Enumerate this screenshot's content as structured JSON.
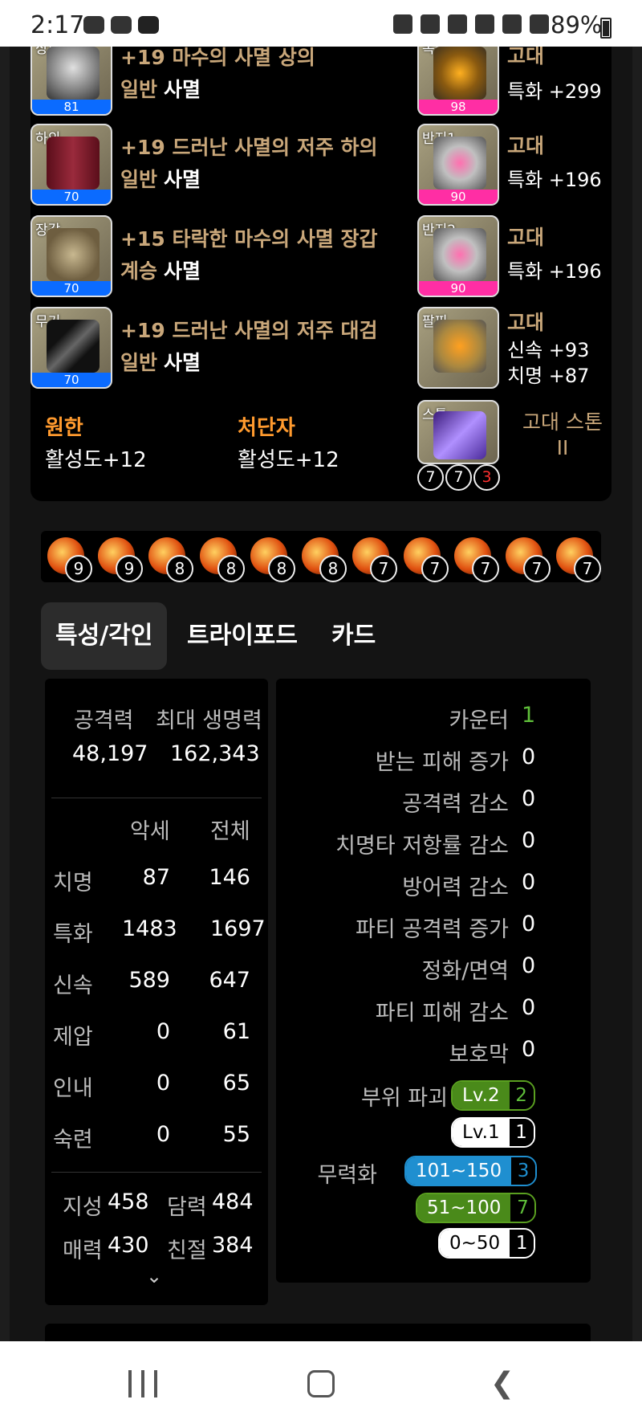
{
  "status_bar": {
    "time": "2:17",
    "battery": "89%",
    "left_icons": [
      "game-icon",
      "kakaotalk-icon",
      "youtube-icon"
    ],
    "right_icons": [
      "clean-icon",
      "alarm-icon",
      "mute-icon",
      "hd-voice-icon",
      "lte-icon",
      "signal-icon"
    ]
  },
  "equipment": {
    "left": [
      {
        "slot": "상의",
        "quality": "81",
        "name": "+19 마수의 사멸 상의",
        "tier": "일반",
        "set": "사멸",
        "bar": "blue"
      },
      {
        "slot": "하의",
        "quality": "70",
        "name": "+19 드러난 사멸의 저주 하의",
        "tier": "일반",
        "set": "사멸",
        "bar": "blue"
      },
      {
        "slot": "장갑",
        "quality": "70",
        "name": "+15 타락한 마수의 사멸 장갑",
        "tier": "계승",
        "set": "사멸",
        "bar": "blue"
      },
      {
        "slot": "무기",
        "quality": "70",
        "name": "+19 드러난 사멸의 저주 대검",
        "tier": "일반",
        "set": "사멸",
        "bar": "blue"
      }
    ],
    "right": [
      {
        "slot": "목걸이",
        "quality": "98",
        "grade": "고대",
        "stats": [
          "특화 +299"
        ]
      },
      {
        "slot": "반지1",
        "quality": "90",
        "grade": "고대",
        "stats": [
          "특화 +196"
        ]
      },
      {
        "slot": "반지2",
        "quality": "90",
        "grade": "고대",
        "stats": [
          "특화 +196"
        ]
      },
      {
        "slot": "팔찌",
        "grade": "고대",
        "stats": [
          "신속 +93",
          "치명 +87"
        ]
      }
    ],
    "engravings": [
      {
        "name": "원한",
        "value": "활성도+12"
      },
      {
        "name": "처단자",
        "value": "활성도+12"
      }
    ],
    "stone": {
      "slot": "스톤",
      "name": "고대 스톤 II",
      "nums": [
        "7",
        "7",
        "3"
      ]
    }
  },
  "gems": [
    "9",
    "9",
    "8",
    "8",
    "8",
    "8",
    "7",
    "7",
    "7",
    "7",
    "7"
  ],
  "tabs": [
    "특성/각인",
    "트라이포드",
    "카드"
  ],
  "stats": {
    "attack_label": "공격력",
    "attack_value": "48,197",
    "hp_label": "최대 생명력",
    "hp_value": "162,343",
    "col_accessory": "악세",
    "col_total": "전체",
    "rows": [
      {
        "name": "치명",
        "acc": "87",
        "total": "146"
      },
      {
        "name": "특화",
        "acc": "1483",
        "total": "1697"
      },
      {
        "name": "신속",
        "acc": "589",
        "total": "647"
      },
      {
        "name": "제압",
        "acc": "0",
        "total": "61"
      },
      {
        "name": "인내",
        "acc": "0",
        "total": "65"
      },
      {
        "name": "숙련",
        "acc": "0",
        "total": "55"
      }
    ],
    "base": [
      {
        "name": "지성",
        "value": "458"
      },
      {
        "name": "담력",
        "value": "484"
      },
      {
        "name": "매력",
        "value": "430"
      },
      {
        "name": "친절",
        "value": "384"
      }
    ]
  },
  "combat": {
    "rows": [
      {
        "label": "카운터",
        "value": "1"
      },
      {
        "label": "받는 피해 증가",
        "value": "0"
      },
      {
        "label": "공격력 감소",
        "value": "0"
      },
      {
        "label": "치명타 저항률 감소",
        "value": "0"
      },
      {
        "label": "방어력 감소",
        "value": "0"
      },
      {
        "label": "파티 공격력 증가",
        "value": "0"
      },
      {
        "label": "정화/면역",
        "value": "0"
      },
      {
        "label": "파티 피해 감소",
        "value": "0"
      },
      {
        "label": "보호막",
        "value": "0"
      }
    ],
    "part_break_label": "부위 파괴",
    "part_break": [
      {
        "level": "Lv.2",
        "count": "2"
      },
      {
        "level": "Lv.1",
        "count": "1"
      }
    ],
    "stagger_label": "무력화",
    "stagger": [
      {
        "range": "101~150",
        "count": "3"
      },
      {
        "range": "51~100",
        "count": "7"
      },
      {
        "range": "0~50",
        "count": "1"
      }
    ]
  }
}
